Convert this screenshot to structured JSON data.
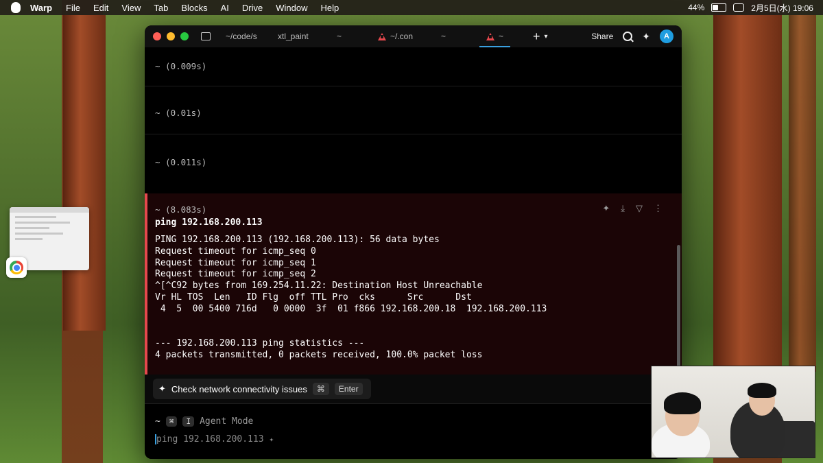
{
  "menubar": {
    "app_name": "Warp",
    "items": [
      "File",
      "Edit",
      "View",
      "Tab",
      "Blocks",
      "AI",
      "Drive",
      "Window",
      "Help"
    ],
    "battery": "44%",
    "battery_level": 0.44,
    "datetime": "2月5日(水)  19:06"
  },
  "window": {
    "tabs": [
      {
        "label": "~/code/s"
      },
      {
        "label": "xtl_paint"
      },
      {
        "label": "~"
      },
      {
        "label": "~/.con",
        "warning": true
      },
      {
        "label": "~"
      },
      {
        "label": "~",
        "warning": true,
        "active": true
      }
    ],
    "share_label": "Share",
    "avatar_letter": "A"
  },
  "blocks": [
    {
      "prompt": "~ (0.009s)"
    },
    {
      "prompt": "~ (0.01s)"
    },
    {
      "prompt": "~ (0.011s)"
    }
  ],
  "error_block": {
    "prompt": "~ (8.083s)",
    "command": "ping 192.168.200.113",
    "output": [
      "PING 192.168.200.113 (192.168.200.113): 56 data bytes",
      "Request timeout for icmp_seq 0",
      "Request timeout for icmp_seq 1",
      "Request timeout for icmp_seq 2",
      "^[^C92 bytes from 169.254.11.22: Destination Host Unreachable",
      "Vr HL TOS  Len   ID Flg  off TTL Pro  cks      Src      Dst",
      " 4  5  00 5400 716d   0 0000  3f  01 f866 192.168.200.18  192.168.200.113",
      "",
      "",
      "--- 192.168.200.113 ping statistics ---",
      "4 packets transmitted, 0 packets received, 100.0% packet loss"
    ]
  },
  "suggestion": {
    "label": "Check network connectivity issues",
    "shortcut_key": "⌘",
    "shortcut_enter": "Enter"
  },
  "input": {
    "prompt": "~",
    "mode_key": "⌘",
    "mode_key2": "I",
    "mode_label": "Agent Mode",
    "value": "ping 192.168.200.113"
  }
}
